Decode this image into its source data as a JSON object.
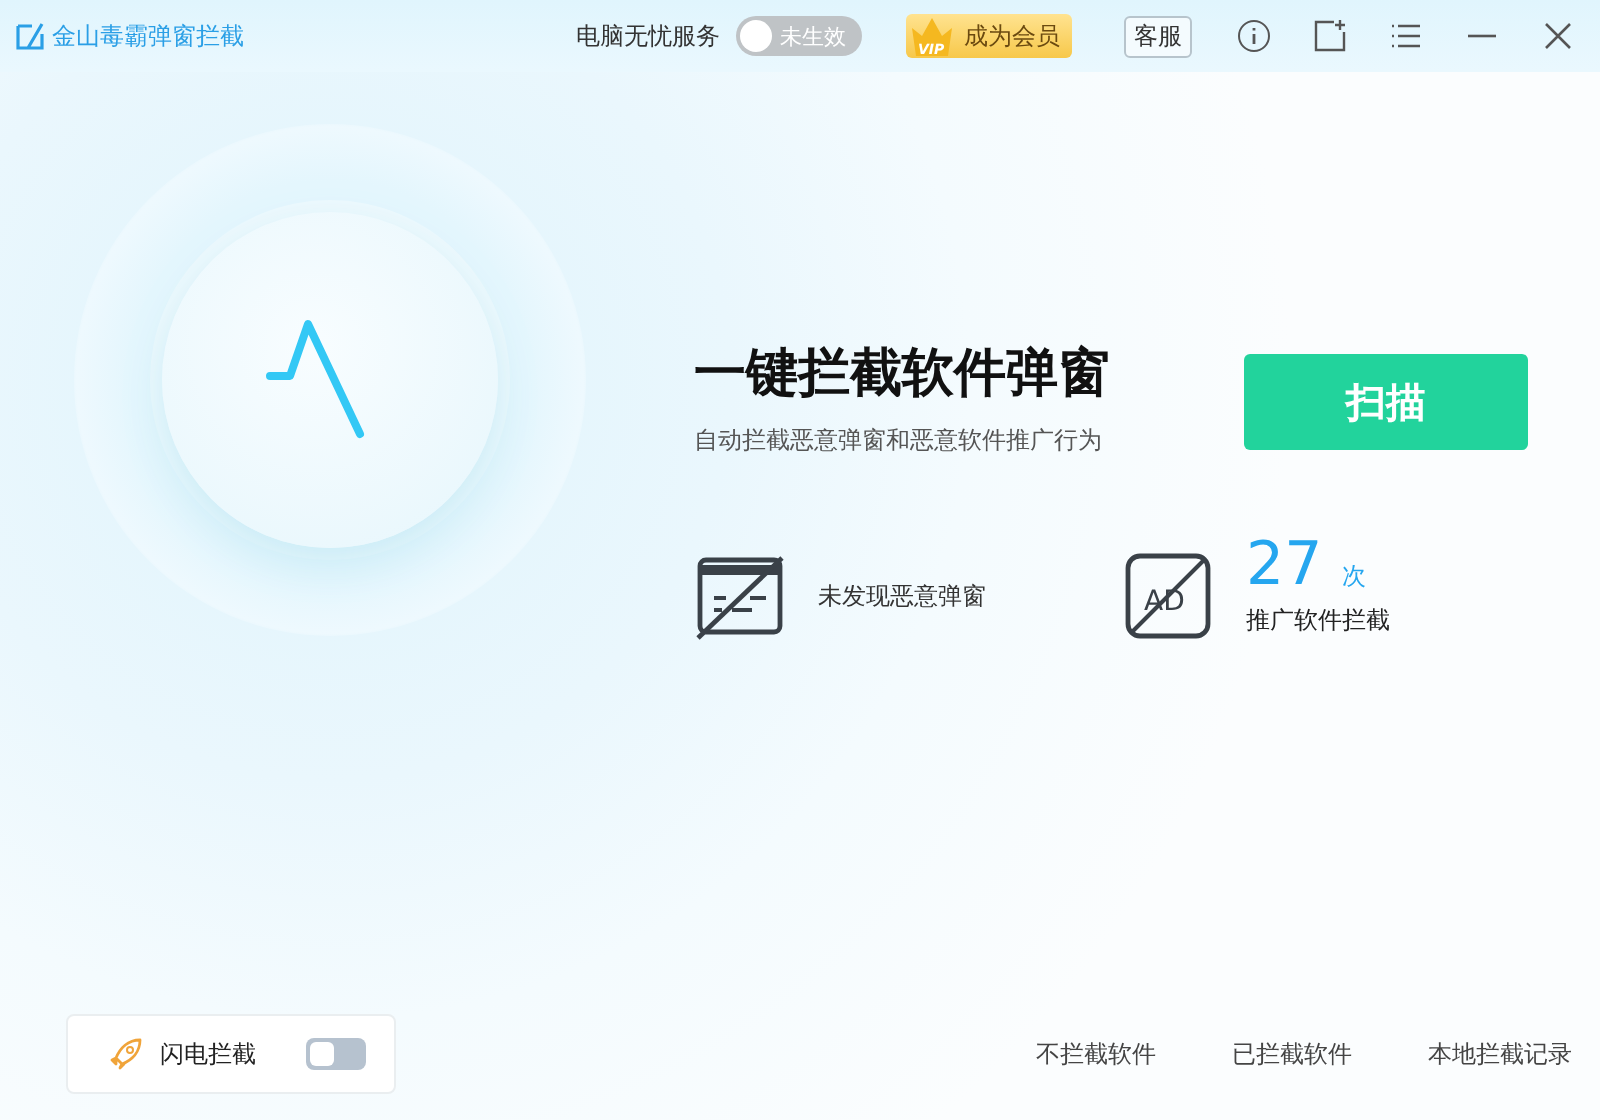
{
  "window": {
    "title": "金山毒霸弹窗拦截"
  },
  "titlebar": {
    "service_label": "电脑无忧服务",
    "service_toggle": {
      "on": false,
      "label": "未生效"
    },
    "vip_badge": "VIP",
    "vip_button": "成为会员",
    "support_button": "客服"
  },
  "main": {
    "headline": "一键拦截软件弹窗",
    "subtitle": "自动拦截恶意弹窗和恶意软件推广行为",
    "scan_button": "扫描",
    "stats": [
      {
        "kind": "popup",
        "label": "未发现恶意弹窗"
      },
      {
        "kind": "ad",
        "icon_text": "AD",
        "count": "27",
        "unit": "次",
        "label": "推广软件拦截"
      }
    ]
  },
  "footer": {
    "flash": {
      "label": "闪电拦截",
      "on": false
    },
    "links": [
      "不拦截软件",
      "已拦截软件",
      "本地拦截记录"
    ]
  }
}
